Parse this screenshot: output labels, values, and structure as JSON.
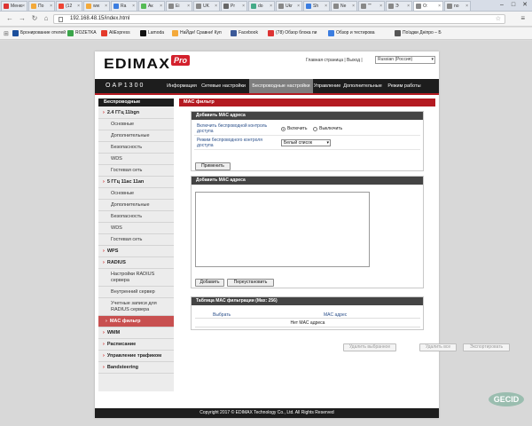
{
  "browser": {
    "tabs": [
      {
        "label": "Меню",
        "color": "#d33"
      },
      {
        "label": "По",
        "color": "#f3a93a"
      },
      {
        "label": "(12",
        "color": "#e43"
      },
      {
        "label": "ww",
        "color": "#f3a93a"
      },
      {
        "label": "Ra",
        "color": "#3b7de0"
      },
      {
        "label": "Ак",
        "color": "#5b5"
      },
      {
        "label": "Ei",
        "color": "#888"
      },
      {
        "label": "UK",
        "color": "#888"
      },
      {
        "label": "Pr",
        "color": "#666"
      },
      {
        "label": "do",
        "color": "#4a8"
      },
      {
        "label": "Ukr",
        "color": "#888"
      },
      {
        "label": "Sh",
        "color": "#3b7de0"
      },
      {
        "label": "Ne",
        "color": "#888"
      },
      {
        "label": "\"\"",
        "color": "#888"
      },
      {
        "label": "Э",
        "color": "#888"
      },
      {
        "label": "O:",
        "color": "#888"
      },
      {
        "label": "no",
        "color": "#888"
      }
    ],
    "window_controls": [
      "–",
      "□",
      "✕"
    ],
    "url": "192.168.48.15/index.html",
    "bookmarks": [
      {
        "label": "Бронирование отелей",
        "color": "#1b4f9c"
      },
      {
        "label": "ROZETKA",
        "color": "#3aa54a"
      },
      {
        "label": "AliExpress",
        "color": "#e43a2b"
      },
      {
        "label": "Lamoda",
        "color": "#111"
      },
      {
        "label": "НаЙди! Сравни! Куп",
        "color": "#f3a93a"
      },
      {
        "label": "Facebook",
        "color": "#3b5998"
      },
      {
        "label": "(78) Обзор блока пи",
        "color": "#d33"
      },
      {
        "label": "Обзор и тестирова",
        "color": "#3b7de0"
      },
      {
        "label": "Поїздки Дніпро – Б",
        "color": "#555"
      }
    ]
  },
  "header": {
    "logo": "EDIMAX",
    "logo_badge": "Pro",
    "links": "Главная страница | Выход |",
    "language": "Russian (Россия)"
  },
  "topnav": {
    "model": "OAP1300",
    "tabs": [
      "Информация",
      "Сетевые настройки",
      "Беспроводные настройки",
      "Управление",
      "Дополнительные",
      "Режим работы"
    ]
  },
  "sidebar": {
    "title": "Беспроводные",
    "items": [
      {
        "label": "2.4 ГГц 11bgn",
        "type": "sec"
      },
      {
        "label": "Основные",
        "type": "sub"
      },
      {
        "label": "Дополнительные",
        "type": "sub"
      },
      {
        "label": "Безопасность",
        "type": "sub"
      },
      {
        "label": "WDS",
        "type": "sub"
      },
      {
        "label": "Гостевая сеть",
        "type": "sub"
      },
      {
        "label": "5 ГГц 11ac 11an",
        "type": "sec"
      },
      {
        "label": "Основные",
        "type": "sub"
      },
      {
        "label": "Дополнительные",
        "type": "sub"
      },
      {
        "label": "Безопасность",
        "type": "sub"
      },
      {
        "label": "WDS",
        "type": "sub"
      },
      {
        "label": "Гостевая сеть",
        "type": "sub"
      },
      {
        "label": "WPS",
        "type": "sec"
      },
      {
        "label": "RADIUS",
        "type": "sec"
      },
      {
        "label": "Настройки RADIUS сервера",
        "type": "sub"
      },
      {
        "label": "Внутренний сервер",
        "type": "sub"
      },
      {
        "label": "Учетные записи для RADIUS сервера",
        "type": "sub"
      },
      {
        "label": "MAC фильтр",
        "type": "active"
      },
      {
        "label": "WMM",
        "type": "sec"
      },
      {
        "label": "Расписание",
        "type": "sec"
      },
      {
        "label": "Управление трафиком",
        "type": "sec"
      },
      {
        "label": "Bandsteering",
        "type": "sec"
      }
    ]
  },
  "content": {
    "title": "MAC фильтр",
    "access_panel": {
      "header": "Добавить MAC адреса",
      "enable_label": "Включить беспроводной контроль доступа",
      "enable_on": "Включить",
      "enable_off": "Выключить",
      "mode_label": "Режим беспроводного контроля доступа",
      "mode_value": "Белый список",
      "apply": "Применить"
    },
    "add_panel": {
      "header": "Добавить MAC адреса",
      "add": "Добавить",
      "reset": "Переустановить"
    },
    "table_panel": {
      "header": "Таблица MAC фильтрации (Max: 256)",
      "col_select": "Выбрать",
      "col_mac": "MAC адрес",
      "empty": "Нет MAC адреса"
    },
    "actions": {
      "delete_selected": "Удалить выбранное",
      "delete_all": "Удалить все",
      "export": "Экспортировать"
    }
  },
  "footer": "Copyright 2017 © EDIMAX Technology Co., Ltd. All Rights Reserved",
  "watermark": "GECID"
}
